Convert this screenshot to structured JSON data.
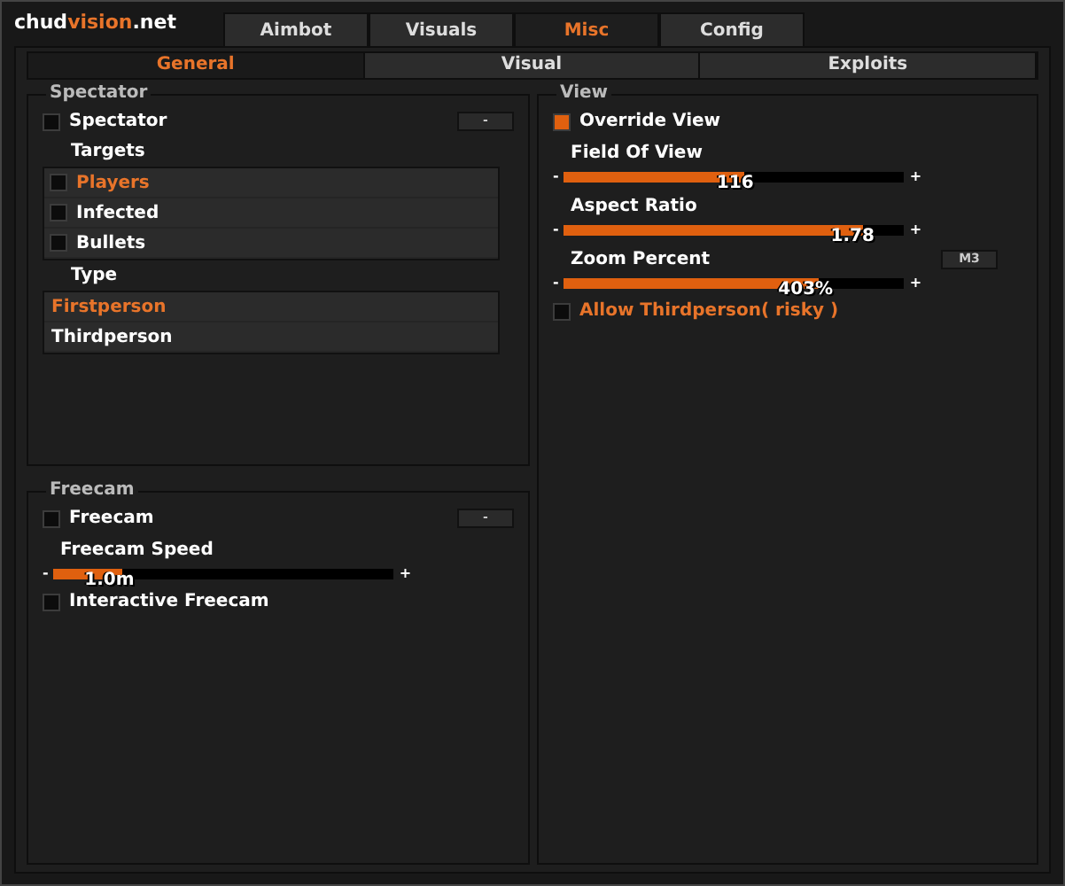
{
  "logo": [
    {
      "text": "chud",
      "accent": false
    },
    {
      "text": "vision",
      "accent": true
    },
    {
      "text": ".net",
      "accent": false
    }
  ],
  "tabs": [
    {
      "label": "Aimbot",
      "selected": false
    },
    {
      "label": "Visuals",
      "selected": false
    },
    {
      "label": "Misc",
      "selected": true
    },
    {
      "label": "Config",
      "selected": false
    }
  ],
  "subtabs": [
    {
      "label": "General",
      "selected": true
    },
    {
      "label": "Visual",
      "selected": false
    },
    {
      "label": "Exploits",
      "selected": false
    }
  ],
  "left_groups": [
    {
      "title": "Spectator",
      "items": [
        {
          "kind": "checkbox",
          "label": "Spectator",
          "checked": false,
          "highlighted": false,
          "keybind": "-"
        },
        {
          "kind": "label",
          "label": "Targets"
        },
        {
          "kind": "checklist",
          "items": [
            {
              "label": "Players",
              "checked": false,
              "selected": true
            },
            {
              "label": "Infected",
              "checked": false,
              "selected": false
            },
            {
              "label": "Bullets",
              "checked": false,
              "selected": false
            }
          ]
        },
        {
          "kind": "label",
          "label": "Type"
        },
        {
          "kind": "listbox",
          "items": [
            {
              "label": "Firstperson",
              "selected": true
            },
            {
              "label": "Thirdperson",
              "selected": false
            }
          ]
        }
      ]
    },
    {
      "title": "Freecam",
      "items": [
        {
          "kind": "checkbox",
          "label": "Freecam",
          "checked": false,
          "highlighted": false,
          "keybind": "-"
        },
        {
          "kind": "slider",
          "label": "Freecam Speed",
          "level": 0.2,
          "reading": "1.0m",
          "minus": "-",
          "plus": "+"
        },
        {
          "kind": "checkbox",
          "label": "Interactive Freecam",
          "checked": false,
          "highlighted": false
        }
      ]
    }
  ],
  "right_group": {
    "title": "View",
    "items": [
      {
        "kind": "checkbox",
        "label": "Override View",
        "checked": true,
        "highlighted": false
      },
      {
        "kind": "slider",
        "label": "Field Of View",
        "level": 0.53,
        "reading": "116",
        "minus": "-",
        "plus": "+"
      },
      {
        "kind": "slider",
        "label": "Aspect Ratio",
        "level": 0.88,
        "reading": "1.78",
        "minus": "-",
        "plus": "+"
      },
      {
        "kind": "slider",
        "label": "Zoom Percent",
        "level": 0.75,
        "reading": "403%",
        "minus": "-",
        "plus": "+",
        "keybind": "M3"
      },
      {
        "kind": "checkbox",
        "label": "Allow Thirdperson( risky )",
        "checked": false,
        "highlighted": true
      }
    ]
  }
}
